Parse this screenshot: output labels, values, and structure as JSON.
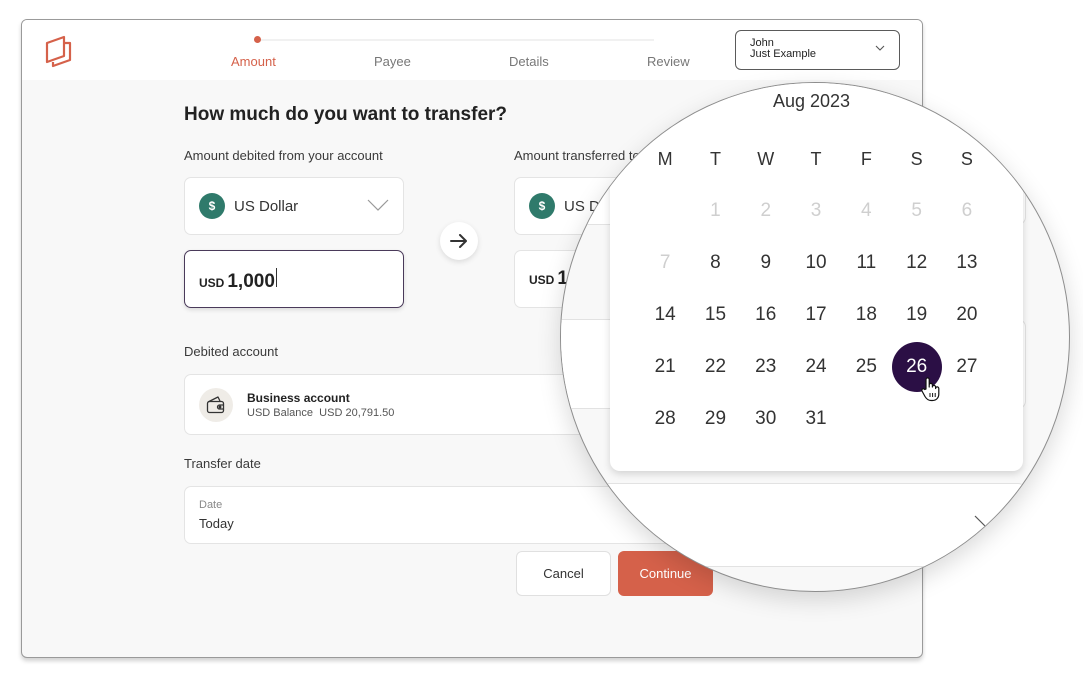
{
  "colors": {
    "brand": "#d5614a",
    "accent_dark": "#2b0f45",
    "coin_green": "#2f7a6b"
  },
  "header": {
    "logo_icon": "stacked-cards-logo",
    "steps": [
      {
        "label": "Amount",
        "active": true
      },
      {
        "label": "Payee",
        "active": false
      },
      {
        "label": "Details",
        "active": false
      },
      {
        "label": "Review",
        "active": false
      }
    ],
    "user": {
      "name": "John",
      "company": "Just Example",
      "icon": "chevron-down-icon"
    }
  },
  "form": {
    "title": "How much do you want to transfer?",
    "debited_label": "Amount debited from your account",
    "transferred_label": "Amount transferred to",
    "from_currency": {
      "icon": "dollar-coin-icon",
      "symbol": "$",
      "name": "US Dollar"
    },
    "to_currency": {
      "icon": "dollar-coin-icon",
      "symbol": "$",
      "name": "US D"
    },
    "from_amount": {
      "currency": "USD",
      "value": "1,000"
    },
    "to_amount": {
      "currency": "USD",
      "value": "1"
    },
    "swap_icon": "arrow-right-icon",
    "debited_account_label": "Debited account",
    "account": {
      "icon": "wallet-icon",
      "name": "Business account",
      "balance_label": "USD Balance",
      "balance_value": "USD 20,791.50"
    },
    "transfer_date_label": "Transfer date",
    "date_field": {
      "label": "Date",
      "value": "Today"
    },
    "cancel_label": "Cancel",
    "continue_label": "Continue"
  },
  "calendar": {
    "month_label": "Aug 2023",
    "weekdays": [
      "M",
      "T",
      "W",
      "T",
      "F",
      "S",
      "S"
    ],
    "weeks": [
      [
        {
          "d": ""
        },
        {
          "d": "1",
          "muted": true
        },
        {
          "d": "2",
          "muted": true
        },
        {
          "d": "3",
          "muted": true
        },
        {
          "d": "4",
          "muted": true
        },
        {
          "d": "5",
          "muted": true
        },
        {
          "d": "6",
          "muted": true
        }
      ],
      [
        {
          "d": "7",
          "muted": true
        },
        {
          "d": "8"
        },
        {
          "d": "9"
        },
        {
          "d": "10"
        },
        {
          "d": "11"
        },
        {
          "d": "12"
        },
        {
          "d": "13"
        }
      ],
      [
        {
          "d": "14"
        },
        {
          "d": "15"
        },
        {
          "d": "16"
        },
        {
          "d": "17"
        },
        {
          "d": "18"
        },
        {
          "d": "19"
        },
        {
          "d": "20"
        }
      ],
      [
        {
          "d": "21"
        },
        {
          "d": "22"
        },
        {
          "d": "23"
        },
        {
          "d": "24"
        },
        {
          "d": "25"
        },
        {
          "d": "26",
          "selected": true
        },
        {
          "d": "27"
        }
      ],
      [
        {
          "d": "28"
        },
        {
          "d": "29"
        },
        {
          "d": "30"
        },
        {
          "d": "31"
        },
        {
          "d": ""
        },
        {
          "d": ""
        },
        {
          "d": ""
        }
      ]
    ],
    "selected_day": "26",
    "cursor_icon": "hand-pointer-icon"
  }
}
